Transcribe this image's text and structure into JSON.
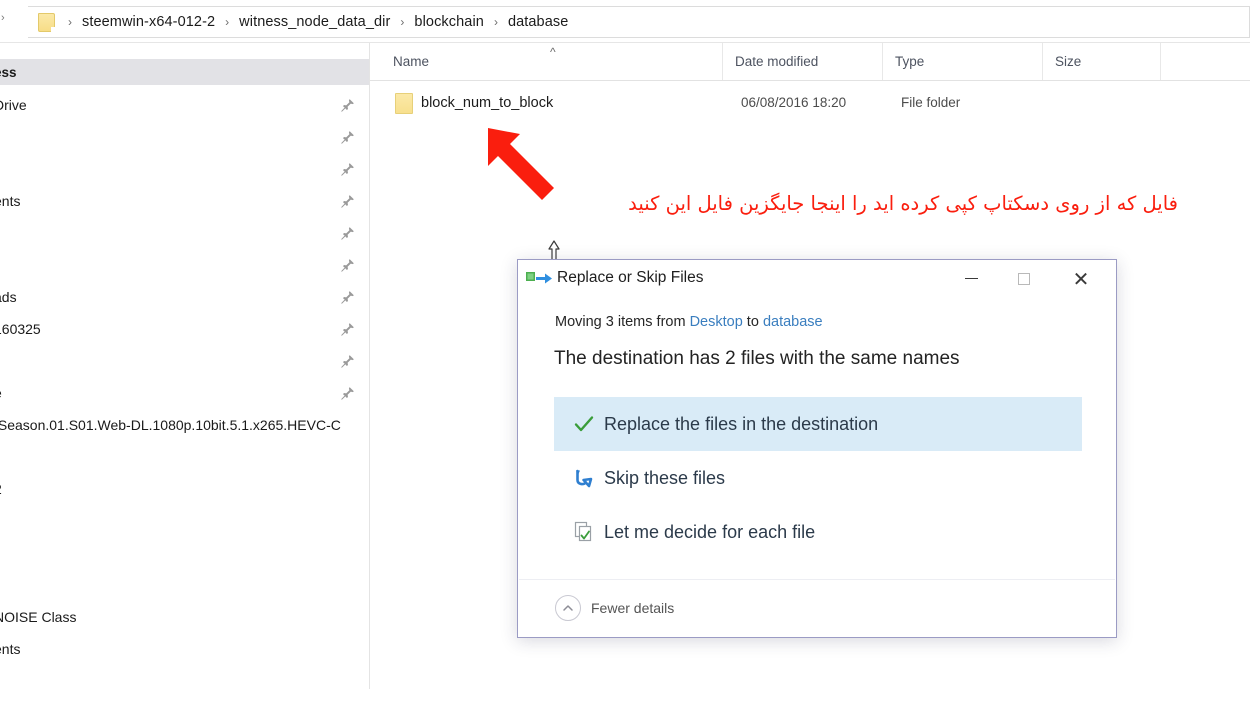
{
  "address_bar": {
    "back_chevron": "chevron-right",
    "folder_icon": "folder-icon",
    "separator": "›",
    "crumbs": [
      "steemwin-x64-012-2",
      "witness_node_data_dir",
      "blockchain",
      "database"
    ]
  },
  "nav_pane": {
    "header": "ess",
    "items": [
      {
        "label": "Drive",
        "pinned": true
      },
      {
        "label": "",
        "pinned": true
      },
      {
        "label": "",
        "pinned": true
      },
      {
        "label": "ents",
        "pinned": true
      },
      {
        "label": "",
        "pinned": true
      },
      {
        "label": "",
        "pinned": true
      },
      {
        "label": "ads",
        "pinned": true
      },
      {
        "label": "160325",
        "pinned": true
      },
      {
        "label": "",
        "pinned": true
      },
      {
        "label": "e",
        "pinned": true
      },
      {
        "label": ".Season.01.S01.Web-DL.1080p.10bit.5.1.x265.HEVC-C",
        "pinned": false
      },
      {
        "label": "",
        "pinned": false
      },
      {
        "label": "2",
        "pinned": false
      },
      {
        "label": "",
        "pinned": false
      },
      {
        "label": "",
        "pinned": false
      },
      {
        "label": "",
        "pinned": false
      },
      {
        "label": "NOISE Class",
        "pinned": false
      },
      {
        "label": "ents",
        "pinned": false
      }
    ]
  },
  "file_list": {
    "columns": [
      {
        "key": "name",
        "label": "Name",
        "sorted": true,
        "sort_dir": "asc"
      },
      {
        "key": "date",
        "label": "Date modified"
      },
      {
        "key": "type",
        "label": "Type"
      },
      {
        "key": "size",
        "label": "Size"
      }
    ],
    "sort_caret": "^",
    "rows": [
      {
        "icon": "folder-icon",
        "name": "block_num_to_block",
        "date": "06/08/2016 18:20",
        "type": "File folder",
        "size": ""
      }
    ]
  },
  "annotation": {
    "text": "فایل که از روی دسکتاپ  کپی کرده اید را اینجا جایگزین فایل این  کنید",
    "color": "#FA1E0E",
    "arrow": "red-arrow-up-left"
  },
  "cursor": {
    "kind": "resize-vertical-cursor"
  },
  "dialog": {
    "icon": "move-files-icon",
    "title": "Replace or Skip Files",
    "window_buttons": {
      "minimize": "minimize-icon",
      "maximize": "maximize-icon",
      "close": "close-icon"
    },
    "subtitle": {
      "prefix": "Moving 3 items from ",
      "source": "Desktop",
      "middle": " to ",
      "destination": "database"
    },
    "heading": "The destination has 2 files with the same names",
    "options": [
      {
        "icon": "green-check-icon",
        "label": "Replace the files in the destination",
        "selected": true
      },
      {
        "icon": "blue-undo-arrow-icon",
        "label": "Skip these files",
        "selected": false
      },
      {
        "icon": "documents-check-icon",
        "label": "Let me decide for each file",
        "selected": false
      }
    ],
    "footer": {
      "toggle_icon": "chevron-up-circle-icon",
      "toggle_label": "Fewer details"
    }
  },
  "colors": {
    "accent_link": "#3A7EBF",
    "selection_bg": "#D9EBF7",
    "annotation_red": "#FA1E0E",
    "folder_yellow": "#F8E08E",
    "dialog_border": "#9B9BC4"
  }
}
